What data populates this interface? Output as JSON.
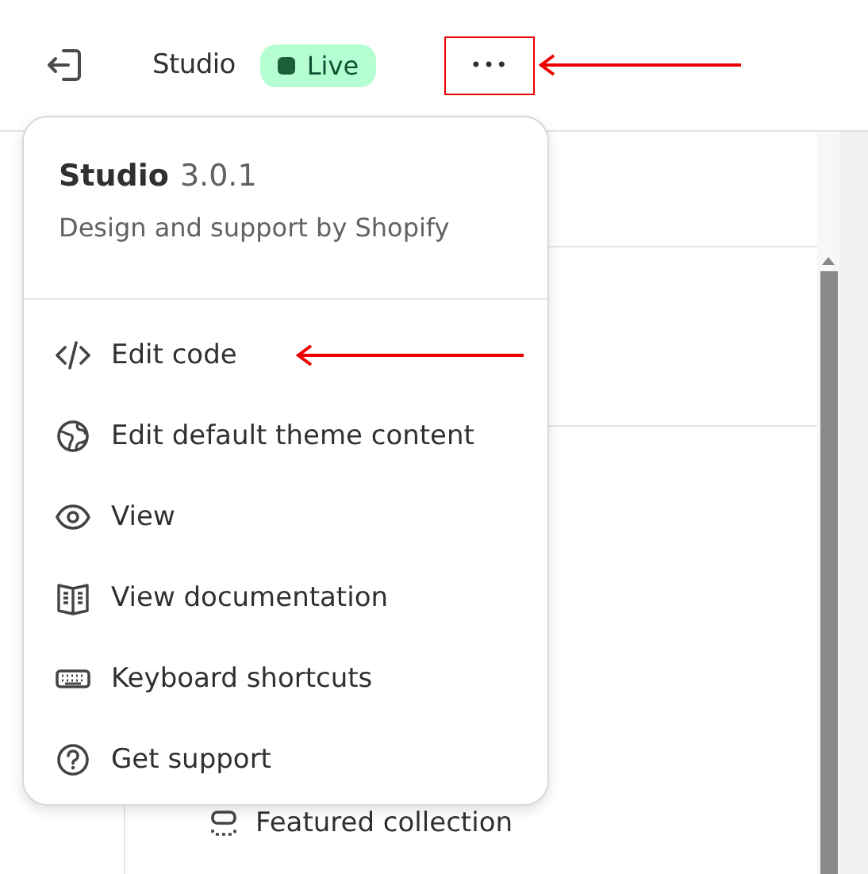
{
  "top_bar": {
    "theme_name": "Studio",
    "status": {
      "label": "Live",
      "color": "#1a5e3a"
    },
    "more_button": "•••"
  },
  "menu": {
    "app_name": "Studio",
    "version": "3.0.1",
    "subtitle": "Design and support by Shopify",
    "items": [
      {
        "kind": "code",
        "label": "Edit code"
      },
      {
        "kind": "globe",
        "label": "Edit default theme content"
      },
      {
        "kind": "eye",
        "label": "View"
      },
      {
        "kind": "book",
        "label": "View documentation"
      },
      {
        "kind": "keyboard",
        "label": "Keyboard shortcuts"
      },
      {
        "kind": "help",
        "label": "Get support"
      }
    ]
  },
  "panel": {
    "section_item": "Featured collection"
  }
}
